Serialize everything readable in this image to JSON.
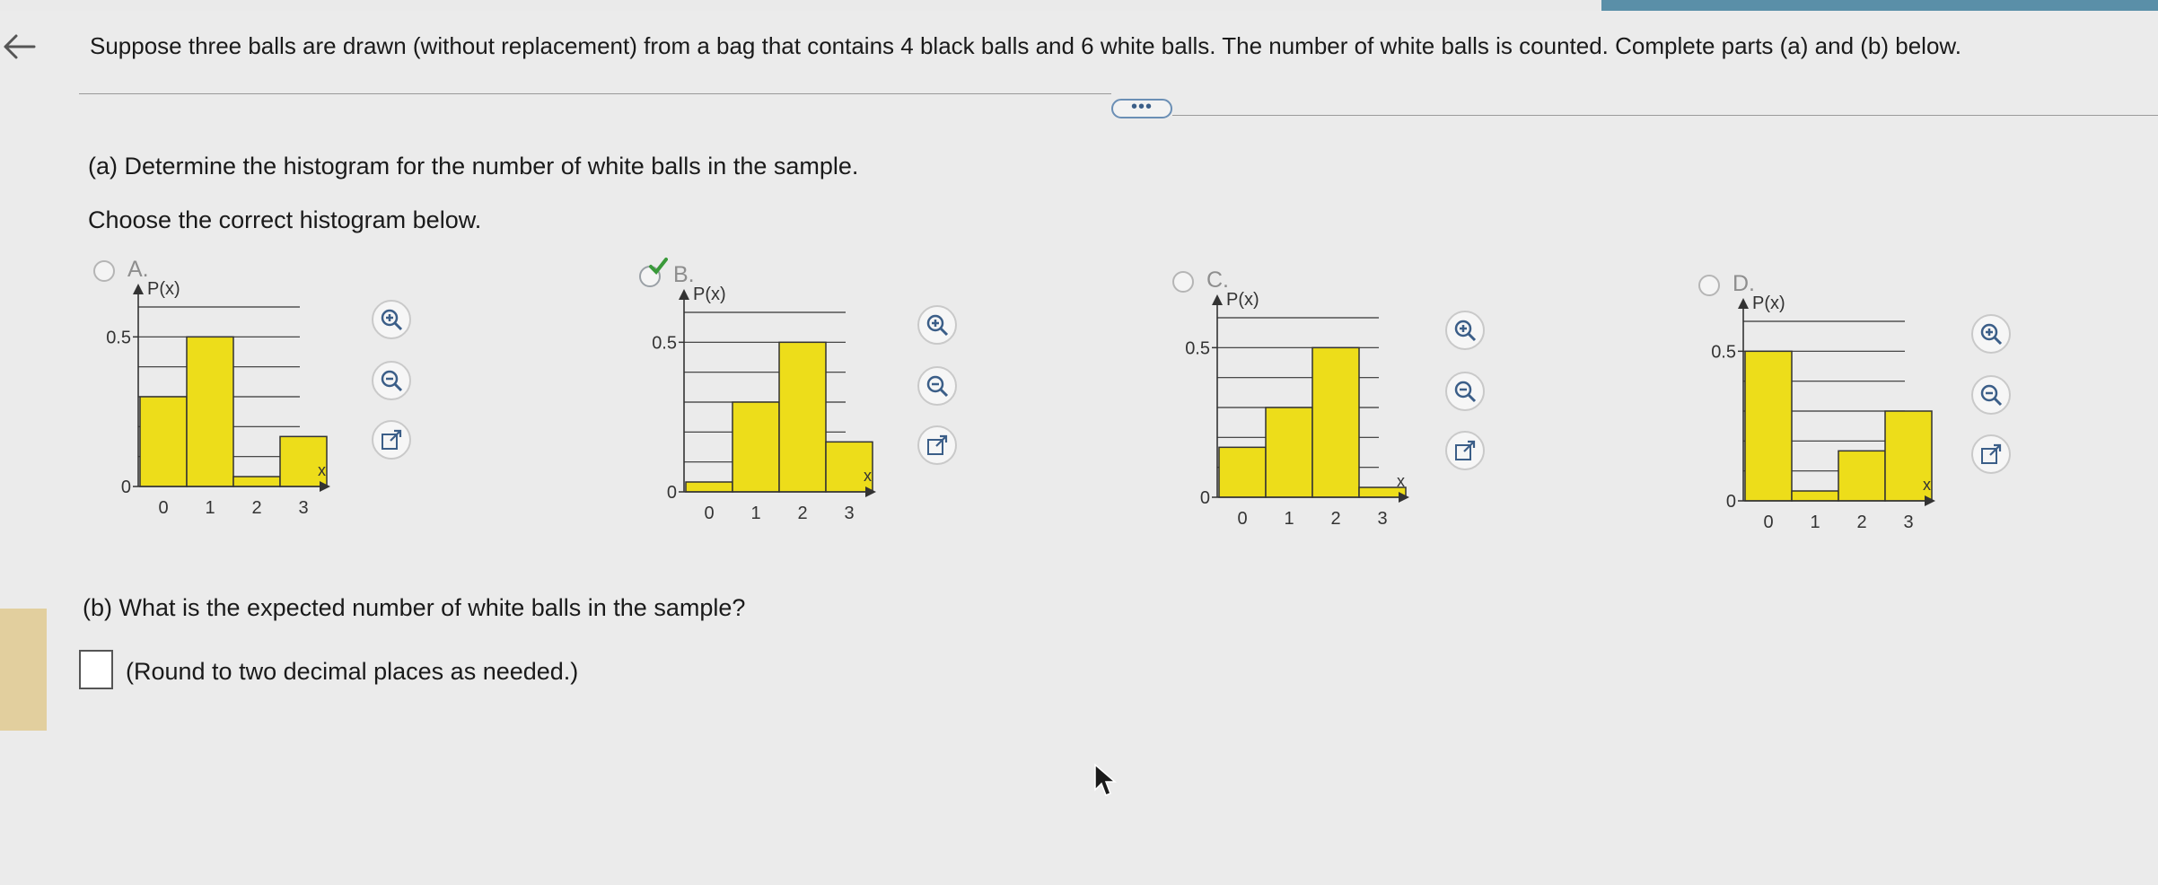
{
  "question": "Suppose three balls are drawn (without replacement) from a bag that contains 4 black balls and 6 white balls. The number of white balls is counted. Complete parts (a) and (b) below.",
  "more_label": "•••",
  "part_a": {
    "prompt": "(a) Determine the histogram for the number of white balls in the sample.",
    "instruction": "Choose the correct histogram below."
  },
  "options": [
    {
      "letter": "A.",
      "selected": false
    },
    {
      "letter": "B.",
      "selected": true
    },
    {
      "letter": "C.",
      "selected": false
    },
    {
      "letter": "D.",
      "selected": false
    }
  ],
  "axis_text": {
    "ylabel": "P(x)",
    "xlabel": "x",
    "y_tick_top": "0.5",
    "y_tick_zero": "0"
  },
  "chart_data": [
    {
      "type": "bar",
      "option": "A",
      "categories": [
        "0",
        "1",
        "2",
        "3"
      ],
      "values": [
        0.3,
        0.5,
        0.033,
        0.167
      ],
      "ylabel": "P(x)",
      "xlabel": "x",
      "ylim": [
        0,
        0.6
      ],
      "yticks": [
        0,
        0.5
      ]
    },
    {
      "type": "bar",
      "option": "B",
      "categories": [
        "0",
        "1",
        "2",
        "3"
      ],
      "values": [
        0.033,
        0.3,
        0.5,
        0.167
      ],
      "ylabel": "P(x)",
      "xlabel": "x",
      "ylim": [
        0,
        0.6
      ],
      "yticks": [
        0,
        0.5
      ]
    },
    {
      "type": "bar",
      "option": "C",
      "categories": [
        "0",
        "1",
        "2",
        "3"
      ],
      "values": [
        0.167,
        0.3,
        0.5,
        0.033
      ],
      "ylabel": "P(x)",
      "xlabel": "x",
      "ylim": [
        0,
        0.6
      ],
      "yticks": [
        0,
        0.5
      ]
    },
    {
      "type": "bar",
      "option": "D",
      "categories": [
        "0",
        "1",
        "2",
        "3"
      ],
      "values": [
        0.5,
        0.033,
        0.167,
        0.3
      ],
      "ylabel": "P(x)",
      "xlabel": "x",
      "ylim": [
        0,
        0.6
      ],
      "yticks": [
        0,
        0.5
      ]
    }
  ],
  "tools": [
    "zoom-in-icon",
    "zoom-out-icon",
    "open-external-icon"
  ],
  "part_b": {
    "prompt": "(b) What is the expected number of white balls in the sample?",
    "answer_value": "",
    "hint": "(Round to two decimal places as needed.)"
  },
  "colors": {
    "bar_fill": "#eddd1a",
    "bar_stroke": "#333333",
    "check": "#3a9a3a",
    "tool_icon": "#3b5e88"
  }
}
